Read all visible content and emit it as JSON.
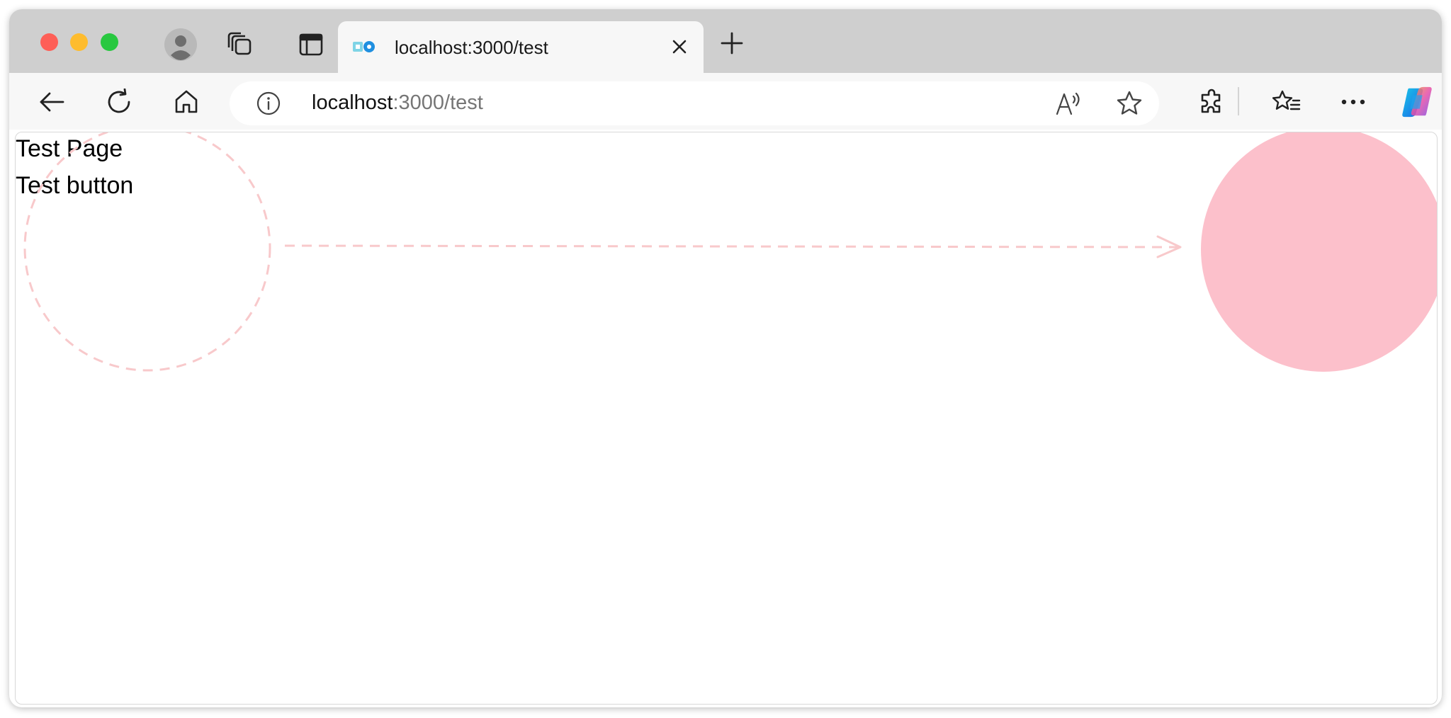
{
  "browser": {
    "tab": {
      "title": "localhost:3000/test",
      "favicon": "storybook-icon"
    },
    "address_bar": {
      "host": "localhost",
      "path": ":3000/test"
    },
    "icons": {
      "profile": "profile-avatar-icon",
      "workspaces": "workspaces-icon",
      "vertical_tabs": "tab-actions-icon",
      "close_tab": "close-icon",
      "new_tab": "plus-icon",
      "back": "back-arrow-icon",
      "refresh": "refresh-icon",
      "home": "home-icon",
      "site_info": "info-icon",
      "read_aloud": "read-aloud-icon",
      "favorite": "star-icon",
      "extensions": "puzzle-icon",
      "favorites": "favorites-icon",
      "more": "more-icon",
      "copilot": "copilot-icon"
    }
  },
  "page": {
    "title": "Test Page",
    "button_label": "Test button",
    "colors": {
      "circle_fill": "#fcc0cb",
      "dashed_stroke": "#f8c9cb",
      "copilot_accent": "#1fa2ec"
    }
  }
}
